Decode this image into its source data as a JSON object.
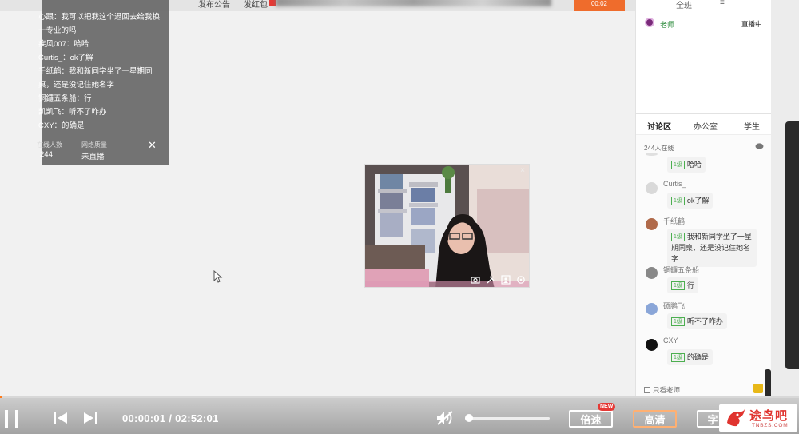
{
  "toolbar": {
    "items": [
      "发布公告",
      "发红包"
    ],
    "status_btn": "00:02"
  },
  "chat_overlay": {
    "lines": [
      "心跟：我可以把我这个退回去给我换",
      "一专业的吗",
      "疾风007：哈哈",
      "Curtis_：ok了解",
      "千纸鹤：我和新同学坐了一星期同",
      "桌，还是没记住她名字",
      "铜鑼五条船：行",
      "凯凯飞：听不了咋办",
      "CXY：的确是"
    ],
    "stat_labels": [
      "在线人数",
      "网络质量"
    ],
    "stat_values": [
      "244",
      "未直播"
    ]
  },
  "right_panel": {
    "view_all": "全班",
    "user": {
      "name": "老师",
      "status": "直播中"
    },
    "tabs": [
      "讨论区",
      "办公室",
      "学生"
    ],
    "online_count": "244人在线",
    "messages": [
      {
        "name": "",
        "text": "哈哈",
        "avatar": "#e0e0e0"
      },
      {
        "name": "Curtis_",
        "text": "ok了解",
        "avatar": "#d9d9d9"
      },
      {
        "name": "千纸鹤",
        "text": "我和新同学坐了一星期同桌，还是没记住她名字",
        "avatar": "#b06a4a"
      },
      {
        "name": "铜鑼五条船",
        "text": "行",
        "avatar": "#888888"
      },
      {
        "name": "硕鹏飞",
        "text": "听不了咋办",
        "avatar": "#8aa6d8"
      },
      {
        "name": "CXY",
        "text": "的确是",
        "avatar": "#111111"
      }
    ],
    "level_tag": "1级",
    "only_teacher": "只看老师"
  },
  "player": {
    "time": "00:00:01 / 02:52:01",
    "progress_fraction": 0.0001,
    "volume_fraction": 0.0,
    "speed_label": "倍速",
    "new_badge": "NEW",
    "quality_label": "高清",
    "subtitle_label": "字"
  },
  "watermark": {
    "text": "途鸟吧",
    "url": "TNBZS.COM"
  },
  "colors": {
    "accent": "#ef6c2c",
    "progress": "#ff7a1a",
    "tag_green": "#4caf50",
    "watermark_red": "#e0342f"
  }
}
